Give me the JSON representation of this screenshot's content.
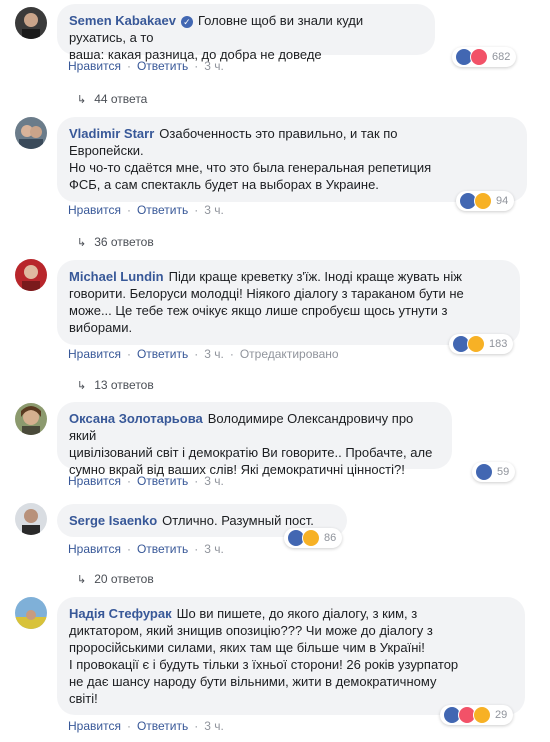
{
  "comments": [
    {
      "author": "Semen Kabakaev",
      "verified": true,
      "text": "Головне щоб ви знали куди рухатись, а то\nваша: какая разница, до добра не доведе",
      "actions": {
        "like": "Нравится",
        "reply": "Ответить",
        "time": "3 ч."
      },
      "reaction_count": "682",
      "reactions": [
        "like-icon",
        "love-icon"
      ],
      "replies": "44 ответа"
    },
    {
      "author": "Vladimir Starr",
      "text": "Озабоченность это правильно, и так по\nЕвропейски.\nНо чо-то сдаётся мне, что это была генеральная репетиция\nФСБ, а сам спектакль будет на выборах в Украине.",
      "actions": {
        "like": "Нравится",
        "reply": "Ответить",
        "time": "3 ч."
      },
      "reaction_count": "94",
      "reactions": [
        "like-icon",
        "haha-icon"
      ],
      "replies": "36 ответов"
    },
    {
      "author": "Michael Lundin",
      "text": "Піди краще креветку з'їж. Іноді краще жувать ніж\nговорити. Белоруси молодці! Ніякого діалогу з тараканом бути не\nможе... Це тебе теж очікує якщо лише спробуєш щось утнути з\nвиборами.",
      "actions": {
        "like": "Нравится",
        "reply": "Ответить",
        "time": "3 ч.",
        "edited": "Отредактировано"
      },
      "reaction_count": "183",
      "reactions": [
        "like-icon",
        "haha-icon"
      ],
      "replies": "13 ответов"
    },
    {
      "author": "Оксана Золотарьова",
      "text": "Володимире Олександровичу про який\nцивілізований світ і демократію Ви говорите.. Пробачте, але\nсумно вкрай від ваших слів! Які демократичні цінності?!",
      "actions": {
        "like": "Нравится",
        "reply": "Ответить",
        "time": "3 ч."
      },
      "reaction_count": "59",
      "reactions": [
        "like-icon"
      ],
      "replies": ""
    },
    {
      "author": "Serge Isaenko",
      "text": "Отлично. Разумный пост.",
      "actions": {
        "like": "Нравится",
        "reply": "Ответить",
        "time": "3 ч."
      },
      "reaction_count": "86",
      "reactions": [
        "like-icon",
        "haha-icon"
      ],
      "replies": "20 ответов"
    },
    {
      "author": "Надія Стефурак",
      "text": "Шо ви пишете, до якого діалогу, з ким, з\nдиктатором, який знищив опозицію??? Чи може до діалогу з\nпроросійськими силами, яких там ще більше чим в Україні!\nІ провокації є і будуть тільки з їхньої сторони! 26 років узурпатор\nне дає шансу народу бути вільними, жити в демократичному\nсвіті!",
      "actions": {
        "like": "Нравится",
        "reply": "Ответить",
        "time": "3 ч."
      },
      "reaction_count": "29",
      "reactions": [
        "like-icon",
        "love-icon",
        "haha-icon"
      ],
      "replies": ""
    }
  ],
  "colors": {
    "link": "#385898",
    "bubble": "#f2f3f5",
    "meta": "#90949c",
    "like": "#4267b2",
    "love": "#f25268",
    "haha": "#f7b125"
  }
}
